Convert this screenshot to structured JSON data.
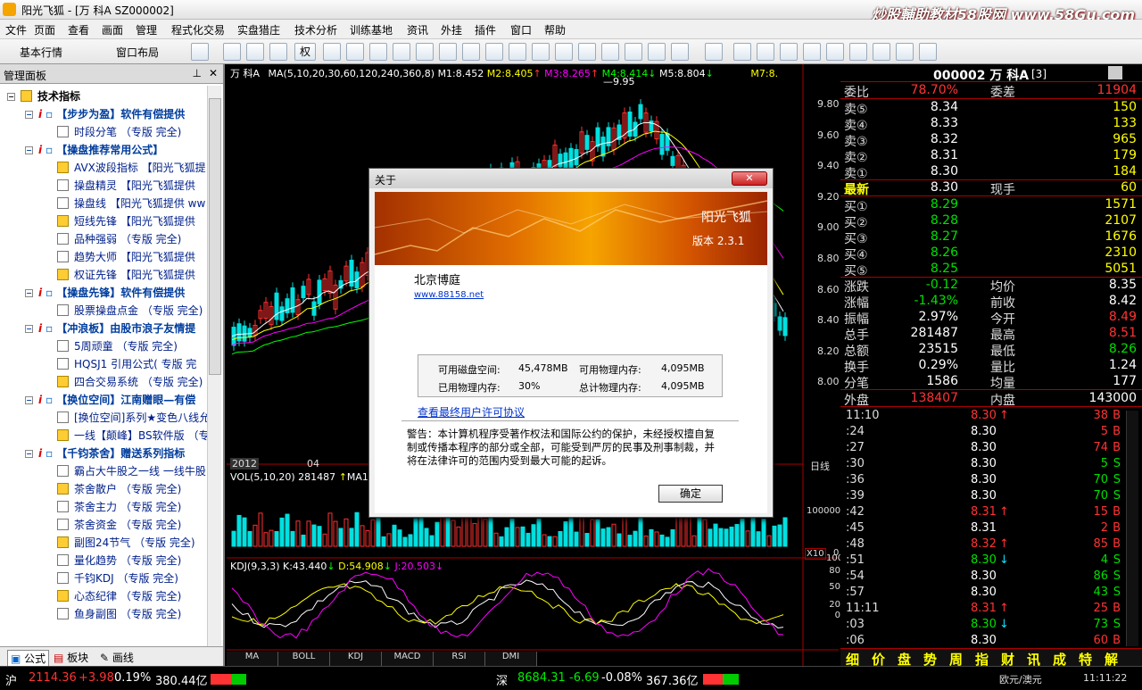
{
  "window": {
    "title": "阳光飞狐 - [万 科A SZ000002]",
    "brand": "炒股輔助教材58股网 www.58Gu.com"
  },
  "menu": [
    "文件",
    "页面",
    "查看",
    "画面",
    "管理",
    "程式化交易",
    "实盘猎庄",
    "技术分析",
    "训练基地",
    "资讯",
    "外挂",
    "插件",
    "窗口",
    "帮助"
  ],
  "toolbar": {
    "basic_quotes": "基本行情",
    "window_layout": "窗口布局",
    "quan": "权"
  },
  "panel": {
    "title": "管理面板",
    "root": "技术指标",
    "items": [
      {
        "type": "group",
        "label": "【步步为盈】软件有偿提供"
      },
      {
        "type": "leaf",
        "label": "时段分笔 （专版 完全)"
      },
      {
        "type": "group",
        "label": "【操盘推荐常用公式】"
      },
      {
        "type": "leaf",
        "label": "AVX波段指标 【阳光飞狐提"
      },
      {
        "type": "leaf",
        "label": "操盘精灵 【阳光飞狐提供"
      },
      {
        "type": "leaf",
        "label": "操盘线 【阳光飞狐提供 ww"
      },
      {
        "type": "leaf",
        "label": "短线先锋 【阳光飞狐提供"
      },
      {
        "type": "leaf",
        "label": "品种强弱 （专版 完全)"
      },
      {
        "type": "leaf",
        "label": "趋势大师 【阳光飞狐提供"
      },
      {
        "type": "leaf",
        "label": "权证先锋 【阳光飞狐提供"
      },
      {
        "type": "group",
        "label": "【操盘先锋】软件有偿提供"
      },
      {
        "type": "leaf",
        "label": "股票操盘点金 （专版 完全)"
      },
      {
        "type": "group",
        "label": "【冲浪板】由股市浪子友情提"
      },
      {
        "type": "leaf",
        "label": "5周顽童 （专版 完全)"
      },
      {
        "type": "leaf",
        "label": "HQSJ1 引用公式( 专版 完"
      },
      {
        "type": "leaf",
        "label": "四合交易系统 （专版 完全)"
      },
      {
        "type": "group",
        "label": "【换位空间】江南赠眼—有偿"
      },
      {
        "type": "leaf",
        "label": "[换位空间]系列★变色八线允"
      },
      {
        "type": "leaf",
        "label": "一线【颠峰】BS软件版 （专"
      },
      {
        "type": "group",
        "label": "【千钧茶舍】赠送系列指标"
      },
      {
        "type": "leaf",
        "label": "霸占大牛股之一线 一线牛股"
      },
      {
        "type": "leaf",
        "label": "茶舍散户 （专版 完全)"
      },
      {
        "type": "leaf",
        "label": "茶舍主力 （专版 完全)"
      },
      {
        "type": "leaf",
        "label": "茶舍资金 （专版 完全)"
      },
      {
        "type": "leaf",
        "label": "副图24节气 （专版 完全)"
      },
      {
        "type": "leaf",
        "label": "量化趋势 （专版 完全)"
      },
      {
        "type": "leaf",
        "label": "千钧KDJ （专版 完全)"
      },
      {
        "type": "leaf",
        "label": "心态纪律 （专版 完全)"
      },
      {
        "type": "leaf",
        "label": "鱼身副图 （专版 完全)"
      }
    ],
    "tabs": [
      "公式",
      "板块",
      "画线"
    ]
  },
  "chart": {
    "stock": "万 科A",
    "ma_line": "MA(5,10,20,30,60,120,240,360,8) M1:8.452",
    "m2": "M2:8.405",
    "m3": "M3:8.265",
    "m4": "M4:8.414",
    "m5": "M5:8.804",
    "m7": "M7:8.",
    "peak": "9.95",
    "price_ticks": [
      "9.80",
      "9.60",
      "9.40",
      "9.20",
      "9.00",
      "8.80",
      "8.60",
      "8.40",
      "8.20",
      "8.00"
    ],
    "x_labels": [
      "2012",
      "04"
    ],
    "period": "日线",
    "vol_line": "VOL(5,10,20) 281487",
    "vol_ma": "MA1:3",
    "vol_tick": "100000",
    "vol_unit": "X10",
    "vol_zero": "0",
    "kdj_line": "KDJ(9,3,3) K:43.440",
    "kdj_d": "D:54.908",
    "kdj_j": "J:20.503",
    "kdj_ticks": [
      "100",
      "80",
      "50",
      "20",
      "0"
    ],
    "tabs": [
      "MA",
      "BOLL",
      "KDJ",
      "MACD",
      "RSI",
      "DMI"
    ]
  },
  "quote": {
    "header": "000002 万 科A",
    "header_suffix": "[3]",
    "weibi_label": "委比",
    "weibi": "78.70%",
    "weicha_label": "委差",
    "weicha": "11904",
    "sells": [
      {
        "label": "卖⑤",
        "price": "8.34",
        "vol": "150"
      },
      {
        "label": "卖④",
        "price": "8.33",
        "vol": "133"
      },
      {
        "label": "卖③",
        "price": "8.32",
        "vol": "965"
      },
      {
        "label": "卖②",
        "price": "8.31",
        "vol": "179"
      },
      {
        "label": "卖①",
        "price": "8.30",
        "vol": "184"
      }
    ],
    "latest_label": "最新",
    "latest": "8.30",
    "xianshou_label": "现手",
    "xianshou": "60",
    "buys": [
      {
        "label": "买①",
        "price": "8.29",
        "vol": "1571"
      },
      {
        "label": "买②",
        "price": "8.28",
        "vol": "2107"
      },
      {
        "label": "买③",
        "price": "8.27",
        "vol": "1676"
      },
      {
        "label": "买④",
        "price": "8.26",
        "vol": "2310"
      },
      {
        "label": "买⑤",
        "price": "8.25",
        "vol": "5051"
      }
    ],
    "stats": [
      {
        "l1": "涨跌",
        "v1": "-0.12",
        "l2": "均价",
        "v2": "8.35",
        "c1": "#00e000",
        "c2": "#fff"
      },
      {
        "l1": "涨幅",
        "v1": "-1.43%",
        "l2": "前收",
        "v2": "8.42",
        "c1": "#00e000",
        "c2": "#fff"
      },
      {
        "l1": "振幅",
        "v1": "2.97%",
        "l2": "今开",
        "v2": "8.49",
        "c1": "#fff",
        "c2": "#f33"
      },
      {
        "l1": "总手",
        "v1": "281487",
        "l2": "最高",
        "v2": "8.51",
        "c1": "#fff",
        "c2": "#f33"
      },
      {
        "l1": "总额",
        "v1": "23515",
        "l2": "最低",
        "v2": "8.26",
        "c1": "#fff",
        "c2": "#00e000"
      },
      {
        "l1": "换手",
        "v1": "0.29%",
        "l2": "量比",
        "v2": "1.24",
        "c1": "#fff",
        "c2": "#fff"
      },
      {
        "l1": "分笔",
        "v1": "1586",
        "l2": "均量",
        "v2": "177",
        "c1": "#fff",
        "c2": "#fff"
      }
    ],
    "waipan_label": "外盘",
    "waipan": "138407",
    "neipan_label": "内盘",
    "neipan": "143000",
    "ticks": [
      {
        "t": "11:10",
        "p": "8.30",
        "d": "up",
        "v": "38",
        "s": "B"
      },
      {
        "t": ":24",
        "p": "8.30",
        "d": "",
        "v": "5",
        "s": "B"
      },
      {
        "t": ":27",
        "p": "8.30",
        "d": "",
        "v": "74",
        "s": "B"
      },
      {
        "t": ":30",
        "p": "8.30",
        "d": "",
        "v": "5",
        "s": "S"
      },
      {
        "t": ":36",
        "p": "8.30",
        "d": "",
        "v": "70",
        "s": "S"
      },
      {
        "t": ":39",
        "p": "8.30",
        "d": "",
        "v": "70",
        "s": "S"
      },
      {
        "t": ":42",
        "p": "8.31",
        "d": "up",
        "v": "15",
        "s": "B"
      },
      {
        "t": ":45",
        "p": "8.31",
        "d": "",
        "v": "2",
        "s": "B"
      },
      {
        "t": ":48",
        "p": "8.32",
        "d": "up",
        "v": "85",
        "s": "B"
      },
      {
        "t": ":51",
        "p": "8.30",
        "d": "down",
        "v": "4",
        "s": "S"
      },
      {
        "t": ":54",
        "p": "8.30",
        "d": "",
        "v": "86",
        "s": "S"
      },
      {
        "t": ":57",
        "p": "8.30",
        "d": "",
        "v": "43",
        "s": "S"
      },
      {
        "t": "11:11",
        "p": "8.31",
        "d": "up",
        "v": "25",
        "s": "B"
      },
      {
        "t": ":03",
        "p": "8.30",
        "d": "down",
        "v": "73",
        "s": "S"
      },
      {
        "t": ":06",
        "p": "8.30",
        "d": "",
        "v": "60",
        "s": "B"
      }
    ],
    "bottom_tabs": [
      "细",
      "价",
      "盘",
      "势",
      "周",
      "指",
      "财",
      "讯",
      "成",
      "特",
      "解"
    ]
  },
  "status": {
    "sh_label": "沪",
    "sh_index": "2114.36",
    "sh_change": "+3.98",
    "sh_pct": "0.19%",
    "sh_amount": "380.44亿",
    "sz_label": "深",
    "sz_index": "8684.31",
    "sz_change": "-6.69",
    "sz_pct": "-0.08%",
    "sz_amount": "367.36亿",
    "fx": "欧元/澳元",
    "time": "11:11:22"
  },
  "dialog": {
    "title": "关于",
    "close": "✕",
    "product": "阳光飞狐",
    "version": "版本 2.3.1",
    "company": "北京博庭",
    "website": "www.88158.net",
    "disk_label": "可用磁盘空间:",
    "disk": "45,478MB",
    "phys_avail_label": "可用物理内存:",
    "phys_avail": "4,095MB",
    "used_label": "已用物理内存:",
    "used": "30%",
    "total_label": "总计物理内存:",
    "total": "4,095MB",
    "license_link": "查看最终用户许可协议",
    "warning": "警告：本计算机程序受著作权法和国际公约的保护，未经授权擅自复制或传播本程序的部分或全部，可能受到严厉的民事及刑事制裁，并将在法律许可的范围内受到最大可能的起诉。",
    "ok": "确定"
  },
  "colors": {
    "up": "#ff3030",
    "down": "#00e000",
    "ma_white": "#ffffff",
    "ma_yellow": "#ffff00",
    "ma_purple": "#c040ff",
    "accent": "#ffcc00"
  }
}
